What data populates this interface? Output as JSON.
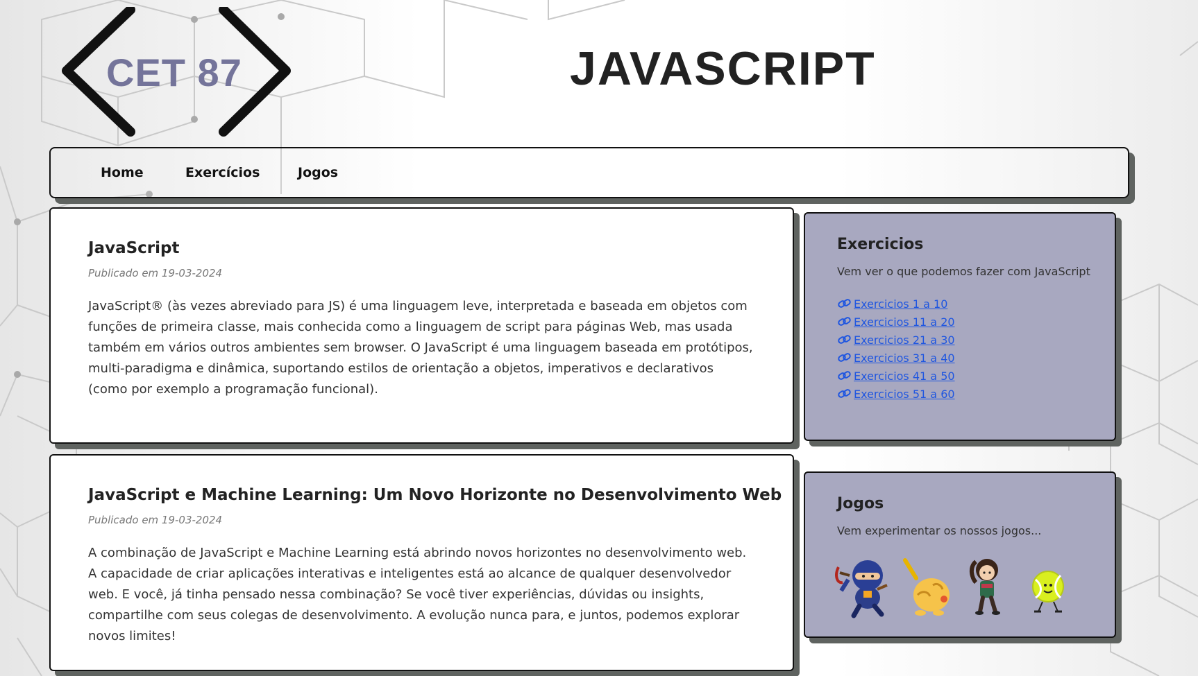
{
  "logo": {
    "text": "CET 87",
    "text_color": "#74749a"
  },
  "header": {
    "title": "JAVASCRIPT"
  },
  "nav": {
    "items": [
      "Home",
      "Exercícios",
      "Jogos"
    ]
  },
  "posts": [
    {
      "title": "JavaScript",
      "date": "Publicado em 19-03-2024",
      "body": "JavaScript® (às vezes abreviado para JS) é uma linguagem leve, interpretada e baseada em objetos com funções de primeira classe, mais conhecida como a linguagem de script para páginas Web, mas usada também em vários outros ambientes sem browser. O JavaScript é uma linguagem baseada em protótipos, multi-paradigma e dinâmica, suportando estilos de orientação a objetos, imperativos e declarativos (como por exemplo a programação funcional)."
    },
    {
      "title": "JavaScript e Machine Learning: Um Novo Horizonte no Desenvolvimento Web",
      "date": "Publicado em 19-03-2024",
      "body": "A combinação de JavaScript e Machine Learning está abrindo novos horizontes no desenvolvimento web. A capacidade de criar aplicações interativas e inteligentes está ao alcance de qualquer desenvolvedor web. E você, já tinha pensado nessa combinação? Se você tiver experiências, dúvidas ou insights, compartilhe com seus colegas de desenvolvimento. A evolução nunca para, e juntos, podemos explorar novos limites!"
    }
  ],
  "sidebar": {
    "exercises": {
      "title": "Exercicios",
      "description": "Vem ver o que podemos fazer com JavaScript",
      "links": [
        "Exercicios 1 a 10",
        "Exercicios 11 a 20",
        "Exercicios 21 a 30",
        "Exercicios 31 a 40",
        "Exercicios 41 a 50",
        "Exercicios 51 a 60"
      ],
      "link_icon": "link-icon",
      "link_color": "#1f56e0"
    },
    "games": {
      "title": "Jogos",
      "description": "Vem experimentar os nossos jogos...",
      "icons": [
        "ninja-game-icon",
        "pikachu-game-icon",
        "girl-character-game-icon",
        "tennis-ball-game-icon"
      ]
    }
  },
  "colors": {
    "sidebar_bg": "#a8a8c0",
    "card_bg": "#ffffff",
    "shadow": "#5f6360",
    "border": "#111111"
  }
}
